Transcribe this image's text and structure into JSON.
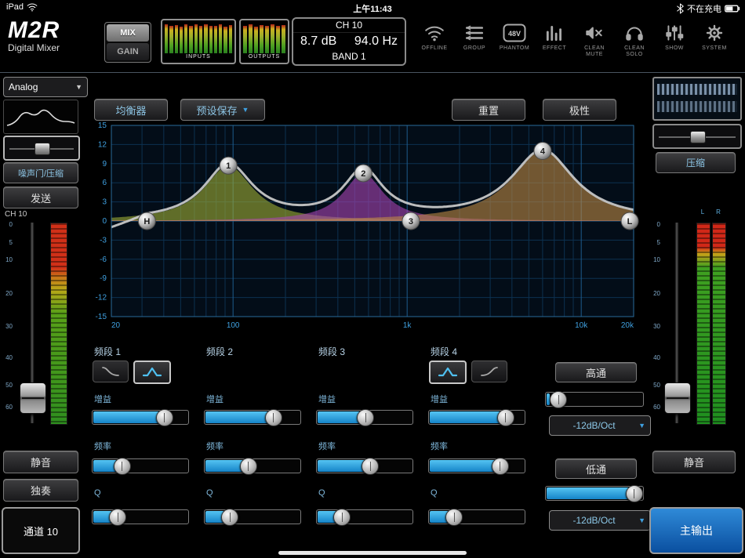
{
  "status_bar": {
    "device": "iPad",
    "time": "上午11:43",
    "battery_status": "不在充电"
  },
  "header": {
    "logo_title": "M2R",
    "logo_subtitle": "Digital Mixer",
    "mix_label": "MIX",
    "gain_label": "GAIN",
    "inputs_label": "INPUTS",
    "outputs_label": "OUTPUTS",
    "inputs_levels": [
      0.95,
      0.9,
      0.93,
      0.88,
      0.96,
      0.9,
      0.94,
      0.89,
      0.95,
      0.91,
      0.9,
      0.96,
      0.88,
      0.93
    ],
    "outputs_levels": [
      0.9,
      0.95,
      0.88,
      0.93,
      0.9,
      0.94,
      0.89,
      0.92
    ],
    "channel_display": {
      "channel": "CH 10",
      "gain": "8.7 dB",
      "freq": "94.0 Hz",
      "band": "BAND 1"
    },
    "icons": [
      {
        "icon": "wifi-icon",
        "label": "OFFLINE"
      },
      {
        "icon": "group-icon",
        "label": "GROUP"
      },
      {
        "icon": "48v-icon",
        "badge": "48V",
        "label": "PHANTOM"
      },
      {
        "icon": "effect-bars-icon",
        "label": "EFFECT"
      },
      {
        "icon": "mute-speaker-icon",
        "label": "CLEAN MUTE"
      },
      {
        "icon": "headphones-icon",
        "label": "CLEAN SOLO"
      },
      {
        "icon": "faders-icon",
        "label": "SHOW"
      },
      {
        "icon": "gear-icon",
        "label": "SYSTEM"
      }
    ]
  },
  "left_panel": {
    "source_select": "Analog",
    "gate_comp_label": "噪声门/压缩",
    "send_label": "发送",
    "channel_label": "CH 10",
    "fader_scale": [
      "0",
      "5",
      "10",
      "20",
      "30",
      "40",
      "50",
      "60"
    ],
    "fader_pos_pct": 87,
    "mute_label": "静音",
    "solo_label": "独奏",
    "channel_button": "通道 10"
  },
  "toolbar": {
    "eq_label": "均衡器",
    "preset_label": "预设保存",
    "reset_label": "重置",
    "polarity_label": "极性"
  },
  "chart_data": {
    "type": "line",
    "subtype": "parametric_eq_response",
    "x_axis": {
      "scale": "log",
      "min_hz": 20,
      "max_hz": 20000,
      "ticks": [
        {
          "v": 20,
          "label": "20"
        },
        {
          "v": 100,
          "label": "100"
        },
        {
          "v": 1000,
          "label": "1k"
        },
        {
          "v": 10000,
          "label": "10k"
        },
        {
          "v": 20000,
          "label": "20k"
        }
      ]
    },
    "y_axis": {
      "unit": "dB",
      "min": -15,
      "max": 15,
      "step": 3,
      "ticks": [
        15,
        12,
        9,
        6,
        3,
        0,
        -3,
        -6,
        -9,
        -12,
        -15
      ]
    },
    "grid": true,
    "bands": [
      {
        "id": "1",
        "freq_hz": 94,
        "gain_db": 8.7,
        "width_dec": 0.17,
        "fill_color": "#9fae36"
      },
      {
        "id": "2",
        "freq_hz": 560,
        "gain_db": 7.5,
        "width_dec": 0.14,
        "fill_color": "#a844b4"
      },
      {
        "id": "3",
        "freq_hz": 1050,
        "gain_db": 0,
        "width_dec": 0.15,
        "fill_color": "#3c8ab4"
      },
      {
        "id": "4",
        "freq_hz": 6000,
        "gain_db": 11,
        "width_dec": 0.22,
        "fill_color": "#bc8844"
      }
    ],
    "filter_handles": [
      {
        "id": "H",
        "freq_hz": 32,
        "gain_db": 0
      },
      {
        "id": "L",
        "freq_hz": 19000,
        "gain_db": 0
      }
    ],
    "curve_color": "#cccccc"
  },
  "bands": [
    {
      "label": "频段 1",
      "gain_label": "增益",
      "freq_label": "频率",
      "q_label": "Q",
      "gain_pct": 79,
      "freq_pct": 26,
      "q_pct": 21,
      "shape_icons": [
        {
          "name": "low-shelf-icon",
          "selected": false
        },
        {
          "name": "bell-icon",
          "selected": true
        }
      ]
    },
    {
      "label": "频段 2",
      "gain_label": "增益",
      "freq_label": "频率",
      "q_label": "Q",
      "gain_pct": 75,
      "freq_pct": 44,
      "q_pct": 21
    },
    {
      "label": "频段 3",
      "gain_label": "增益",
      "freq_label": "频率",
      "q_label": "Q",
      "gain_pct": 50,
      "freq_pct": 56,
      "q_pct": 21
    },
    {
      "label": "频段 4",
      "gain_label": "增益",
      "freq_label": "频率",
      "q_label": "Q",
      "gain_pct": 85,
      "freq_pct": 78,
      "q_pct": 21,
      "shape_icons": [
        {
          "name": "bell-icon",
          "selected": true
        },
        {
          "name": "high-shelf-icon",
          "selected": false
        }
      ]
    }
  ],
  "filters": {
    "hp_label": "高通",
    "hp_pct": 5,
    "hp_slope": "-12dB/Oct",
    "lp_label": "低通",
    "lp_pct": 98,
    "lp_slope": "-12dB/Oct"
  },
  "right_panel": {
    "comp_label": "压缩",
    "meter_labels": [
      "L",
      "R"
    ],
    "fader_scale": [
      "0",
      "5",
      "10",
      "20",
      "30",
      "40",
      "50",
      "60"
    ],
    "fader_pos_pct": 87,
    "mute_label": "静音",
    "main_out_label": "主输出"
  },
  "colors": {
    "accent_blue": "#2fa8e8",
    "button_text_blue": "#8cc4e4",
    "meter_green": "#2f8f1f",
    "meter_red": "#d03018",
    "main_out_blue": "#1878c8"
  }
}
